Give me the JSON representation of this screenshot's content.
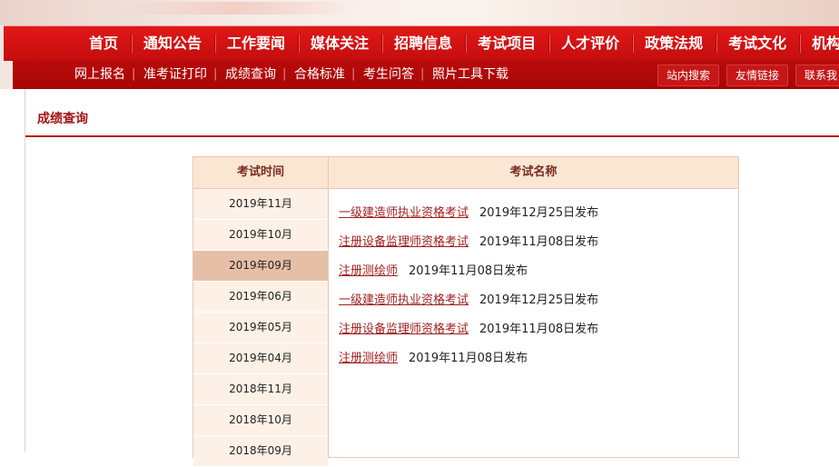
{
  "main_nav": [
    "首页",
    "通知公告",
    "工作要闻",
    "媒体关注",
    "招聘信息",
    "考试项目",
    "人才评价",
    "政策法规",
    "考试文化",
    "机构介绍"
  ],
  "sub_nav": [
    "网上报名",
    "准考证打印",
    "成绩查询",
    "合格标准",
    "考生问答",
    "照片工具下载"
  ],
  "sub_buttons": [
    "站内搜索",
    "友情链接",
    "联系我"
  ],
  "page_title": "成绩查询",
  "table": {
    "col_time": "考试时间",
    "col_name": "考试名称",
    "dates": [
      "2019年11月",
      "2019年10月",
      "2019年09月",
      "2019年06月",
      "2019年05月",
      "2019年04月",
      "2018年11月",
      "2018年10月",
      "2018年09月"
    ],
    "selected_index": 2,
    "exams": [
      {
        "name": "一级建造师执业资格考试",
        "published": "2019年12月25日发布"
      },
      {
        "name": "注册设备监理师资格考试",
        "published": "2019年11月08日发布"
      },
      {
        "name": "注册测绘师",
        "published": "2019年11月08日发布"
      },
      {
        "name": "一级建造师执业资格考试",
        "published": "2019年12月25日发布"
      },
      {
        "name": "注册设备监理师资格考试",
        "published": "2019年11月08日发布"
      },
      {
        "name": "注册测绘师",
        "published": "2019年11月08日发布"
      }
    ]
  },
  "colors": {
    "nav_red": "#d31212",
    "subnav_red": "#b10909",
    "highlight": "#e6bfa7",
    "link": "#a11f1f"
  }
}
